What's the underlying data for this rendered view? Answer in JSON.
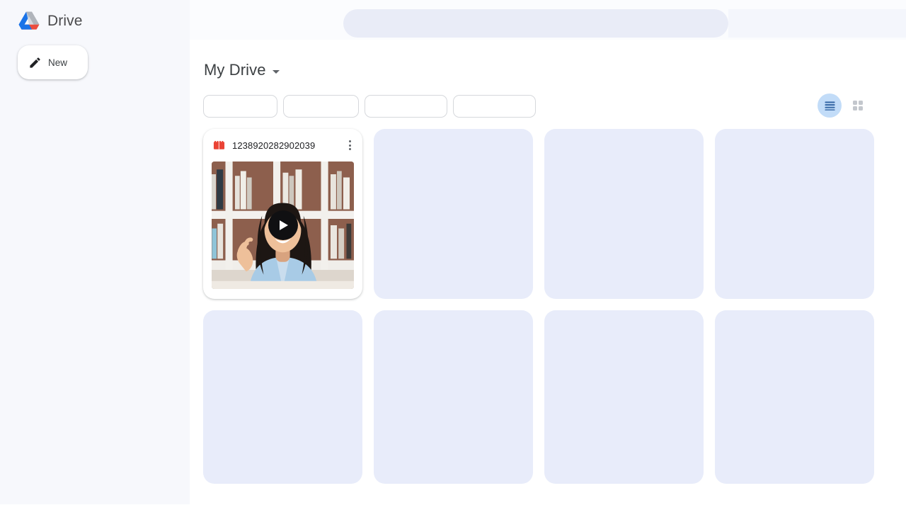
{
  "app": {
    "name": "Drive",
    "logo_icon": "google-drive-logo"
  },
  "sidebar": {
    "new_button": {
      "label": "New",
      "icon": "pencil-icon"
    }
  },
  "topbar": {
    "search": {
      "placeholder": "",
      "value": "",
      "state": "loading-skeleton"
    }
  },
  "main": {
    "breadcrumb": {
      "title": "My Drive",
      "caret_icon": "chevron-down-icon"
    },
    "filters": [
      {
        "label": "",
        "state": "empty"
      },
      {
        "label": "",
        "state": "empty"
      },
      {
        "label": "",
        "state": "empty"
      },
      {
        "label": "",
        "state": "empty"
      }
    ],
    "view_toggles": [
      {
        "name": "list-view",
        "icon": "list-view-icon",
        "selected": true
      },
      {
        "name": "grid-view",
        "icon": "grid-view-icon",
        "selected": false
      }
    ],
    "files": [
      {
        "name": "1238920282902039",
        "type": "video",
        "icon": "video-file-icon",
        "icon_color": "#ea4335",
        "has_thumbnail": true,
        "overlay_icon": "play-icon",
        "more_icon": "more-vert-icon"
      }
    ],
    "placeholder_tiles_row1": 3,
    "placeholder_tiles_row2": 4
  },
  "colors": {
    "page_background": "#ffffff",
    "sidebar_background": "#f7f8fc",
    "panel_background": "#ffffff",
    "placeholder_tile": "#e8ecfa",
    "search_skeleton": "#e9ecf7",
    "toggle_active": "#c2dcf8",
    "toggle_active_icon": "#3b6ca8",
    "toggle_inactive_icon": "#c3c7cd",
    "chip_border": "#d6d8dc",
    "text_primary": "#3c4043",
    "text_secondary": "#5f6368",
    "drive_red": "#ea4335"
  }
}
